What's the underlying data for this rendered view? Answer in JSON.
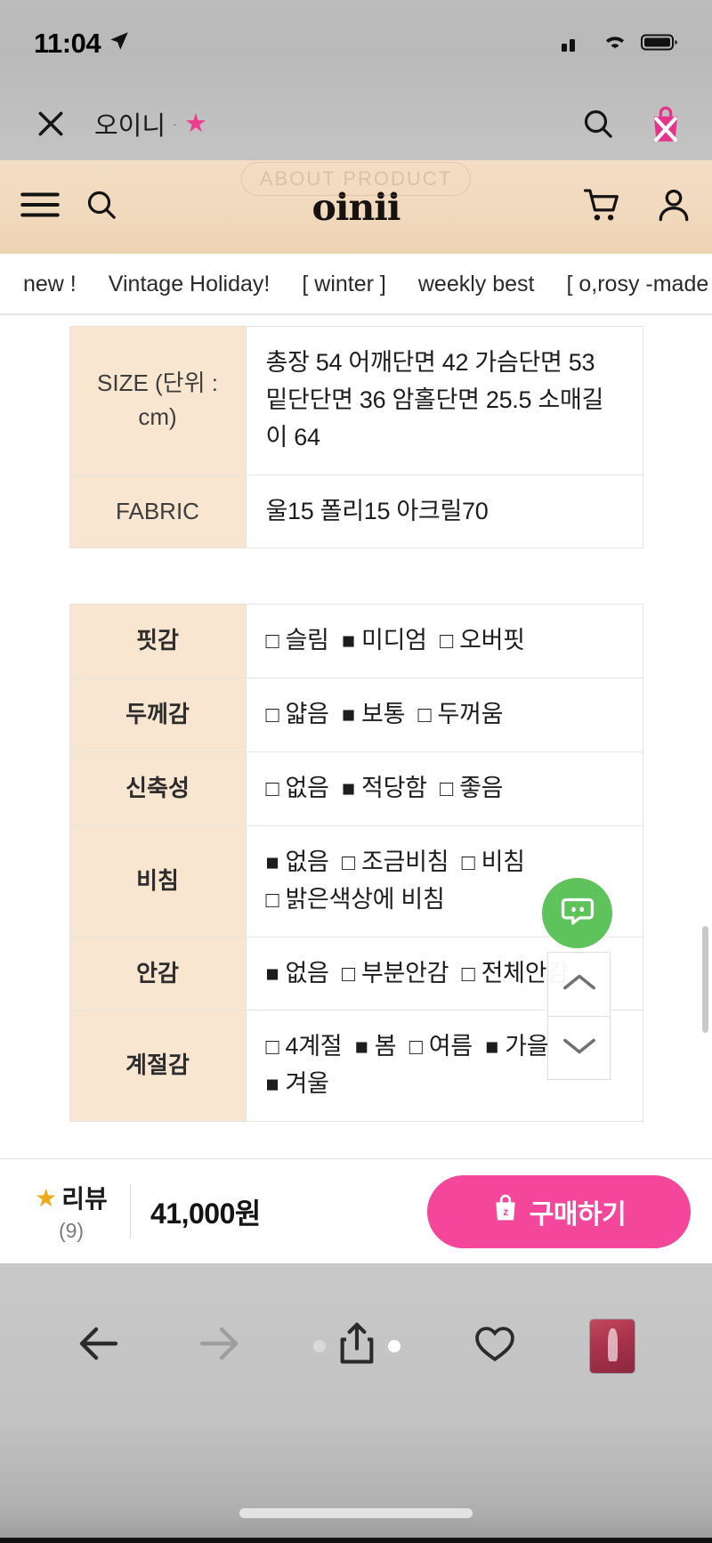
{
  "status_bar": {
    "time": "11:04",
    "location_icon": "location-arrow-icon",
    "cellular_icon": "cellular-signal-icon",
    "wifi_icon": "wifi-icon",
    "battery_icon": "battery-full-icon"
  },
  "browser_site_bar": {
    "close_icon": "close-x-icon",
    "site_title": "오이니",
    "separator": "·",
    "favorite_icon": "star-filled-icon",
    "search_icon": "search-icon",
    "shop_icon": "shopping-bag-blocked-icon"
  },
  "site_header": {
    "menu_icon": "hamburger-menu-icon",
    "search_icon": "search-icon",
    "logo": "oinii",
    "cart_icon": "shopping-cart-icon",
    "account_icon": "user-account-icon",
    "watermark": "ABOUT PRODUCT"
  },
  "category_nav": {
    "items": [
      {
        "label": "new !"
      },
      {
        "label": "Vintage Holiday!"
      },
      {
        "label": "[ winter ]"
      },
      {
        "label": "weekly best"
      },
      {
        "label": "[ o,rosy -made"
      }
    ]
  },
  "spec_table": {
    "rows": [
      {
        "label": "SIZE (단위 : cm)",
        "value": "총장 54 어깨단면 42 가슴단면 53 밑단단면 36 암홀단면 25.5 소매길이 64"
      },
      {
        "label": "FABRIC",
        "value": "울15 폴리15 아크릴70"
      }
    ]
  },
  "attribute_table": {
    "rows": [
      {
        "label": "핏감",
        "options": [
          {
            "text": "슬림",
            "checked": false
          },
          {
            "text": "미디엄",
            "checked": true
          },
          {
            "text": "오버핏",
            "checked": false
          }
        ]
      },
      {
        "label": "두께감",
        "options": [
          {
            "text": "얇음",
            "checked": false
          },
          {
            "text": "보통",
            "checked": true
          },
          {
            "text": "두꺼움",
            "checked": false
          }
        ]
      },
      {
        "label": "신축성",
        "options": [
          {
            "text": "없음",
            "checked": false
          },
          {
            "text": "적당함",
            "checked": true
          },
          {
            "text": "좋음",
            "checked": false
          }
        ]
      },
      {
        "label": "비침",
        "options": [
          {
            "text": "없음",
            "checked": true
          },
          {
            "text": "조금비침",
            "checked": false
          },
          {
            "text": "비침",
            "checked": false
          },
          {
            "text": "밝은색상에 비침",
            "checked": false
          }
        ]
      },
      {
        "label": "안감",
        "options": [
          {
            "text": "없음",
            "checked": true
          },
          {
            "text": "부분안감",
            "checked": false
          },
          {
            "text": "전체안감",
            "checked": false
          }
        ]
      },
      {
        "label": "계절감",
        "options": [
          {
            "text": "4계절",
            "checked": false
          },
          {
            "text": "봄",
            "checked": true
          },
          {
            "text": "여름",
            "checked": false
          },
          {
            "text": "가을",
            "checked": true
          },
          {
            "text": "겨울",
            "checked": true
          }
        ]
      }
    ]
  },
  "floating": {
    "chat_icon": "kakao-chat-bubble-icon",
    "chat_color": "#5ec35a",
    "scroll_up_icon": "chevron-up-icon",
    "scroll_down_icon": "chevron-down-icon"
  },
  "purchase_bar": {
    "review_label": "리뷰",
    "review_star_icon": "star-filled-icon",
    "review_count": "(9)",
    "price": "41,000원",
    "buy_icon": "shopping-bag-icon",
    "buy_label": "구매하기",
    "buy_color": "#f4469b"
  },
  "browser_toolbar": {
    "back_icon": "back-arrow-icon",
    "forward_icon": "forward-arrow-icon",
    "share_icon": "share-upload-icon",
    "bookmark_icon": "heart-outline-icon",
    "tabs_icon": "tab-thumbnail-icon"
  }
}
